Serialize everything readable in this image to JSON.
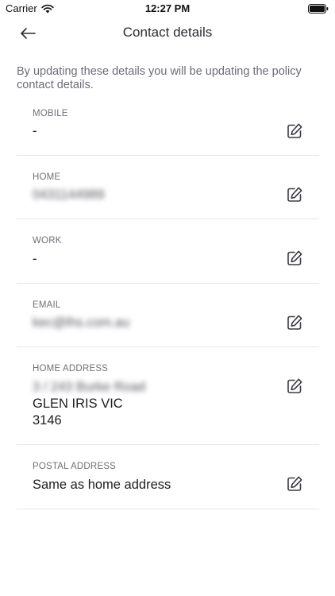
{
  "status_bar": {
    "carrier": "Carrier",
    "time": "12:27 PM"
  },
  "nav": {
    "title": "Contact details"
  },
  "intro": "By updating these details you will be updating the policy contact details.",
  "fields": [
    {
      "label": "MOBILE",
      "value": "-"
    },
    {
      "label": "HOME",
      "value": "0431144989"
    },
    {
      "label": "WORK",
      "value": "-"
    },
    {
      "label": "EMAIL",
      "value": "kec@lhs.com.au"
    },
    {
      "label": "HOME ADDRESS",
      "address_line1": "3 / 243 Burke Road",
      "address_line2": "GLEN IRIS VIC",
      "address_line3": "3146"
    },
    {
      "label": "POSTAL ADDRESS",
      "value": "Same as home address"
    }
  ],
  "icons": {
    "back": "arrow-left-icon",
    "edit": "edit-pencil-icon"
  },
  "colors": {
    "text": "#1d1d22",
    "muted": "#6c6c78",
    "divider": "#e6e6ea",
    "icon": "#3a3a44"
  }
}
